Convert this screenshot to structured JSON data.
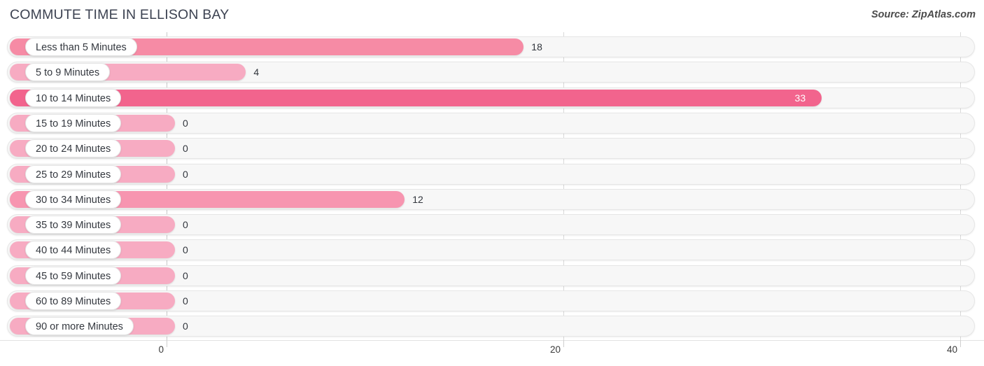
{
  "header": {
    "title": "COMMUTE TIME IN ELLISON BAY",
    "source": "Source: ZipAtlas.com"
  },
  "colors": {
    "bar_light": "#f7abc2",
    "bar_mid_light": "#f795b0",
    "bar_mid": "#f68ba5",
    "bar_dark": "#f2648d",
    "track_bg": "#f7f7f7",
    "track_border": "#e6e6e6",
    "gridline": "#d9d9d9",
    "text": "#32363d",
    "title": "#3c4251"
  },
  "chart_data": {
    "type": "bar",
    "orientation": "horizontal",
    "title": "COMMUTE TIME IN ELLISON BAY",
    "xlabel": "",
    "ylabel": "",
    "xlim": [
      0,
      40
    ],
    "xticks": [
      0,
      20,
      40
    ],
    "xtick_labels": [
      "0",
      "20",
      "40"
    ],
    "grid": true,
    "legend": "none",
    "categories": [
      "Less than 5 Minutes",
      "5 to 9 Minutes",
      "10 to 14 Minutes",
      "15 to 19 Minutes",
      "20 to 24 Minutes",
      "25 to 29 Minutes",
      "30 to 34 Minutes",
      "35 to 39 Minutes",
      "40 to 44 Minutes",
      "45 to 59 Minutes",
      "60 to 89 Minutes",
      "90 or more Minutes"
    ],
    "values": [
      18,
      4,
      33,
      0,
      0,
      0,
      12,
      0,
      0,
      0,
      0,
      0
    ],
    "value_labels": [
      "18",
      "4",
      "33",
      "0",
      "0",
      "0",
      "12",
      "0",
      "0",
      "0",
      "0",
      "0"
    ]
  },
  "rows": [
    {
      "label": "Less than 5 Minutes",
      "value": 18,
      "value_label": "18",
      "color": "#f68ba5",
      "label_inside": false
    },
    {
      "label": "5 to 9 Minutes",
      "value": 4,
      "value_label": "4",
      "color": "#f7abc2",
      "label_inside": false
    },
    {
      "label": "10 to 14 Minutes",
      "value": 33,
      "value_label": "33",
      "color": "#f2648d",
      "label_inside": true
    },
    {
      "label": "15 to 19 Minutes",
      "value": 0,
      "value_label": "0",
      "color": "#f7abc2",
      "label_inside": false
    },
    {
      "label": "20 to 24 Minutes",
      "value": 0,
      "value_label": "0",
      "color": "#f7abc2",
      "label_inside": false
    },
    {
      "label": "25 to 29 Minutes",
      "value": 0,
      "value_label": "0",
      "color": "#f7abc2",
      "label_inside": false
    },
    {
      "label": "30 to 34 Minutes",
      "value": 12,
      "value_label": "12",
      "color": "#f795b0",
      "label_inside": false
    },
    {
      "label": "35 to 39 Minutes",
      "value": 0,
      "value_label": "0",
      "color": "#f7abc2",
      "label_inside": false
    },
    {
      "label": "40 to 44 Minutes",
      "value": 0,
      "value_label": "0",
      "color": "#f7abc2",
      "label_inside": false
    },
    {
      "label": "45 to 59 Minutes",
      "value": 0,
      "value_label": "0",
      "color": "#f7abc2",
      "label_inside": false
    },
    {
      "label": "60 to 89 Minutes",
      "value": 0,
      "value_label": "0",
      "color": "#f7abc2",
      "label_inside": false
    },
    {
      "label": "90 or more Minutes",
      "value": 0,
      "value_label": "0",
      "color": "#f7abc2",
      "label_inside": false
    }
  ],
  "axis": {
    "ticks": [
      {
        "label": "0",
        "value": 0
      },
      {
        "label": "20",
        "value": 20
      },
      {
        "label": "40",
        "value": 40
      }
    ]
  }
}
